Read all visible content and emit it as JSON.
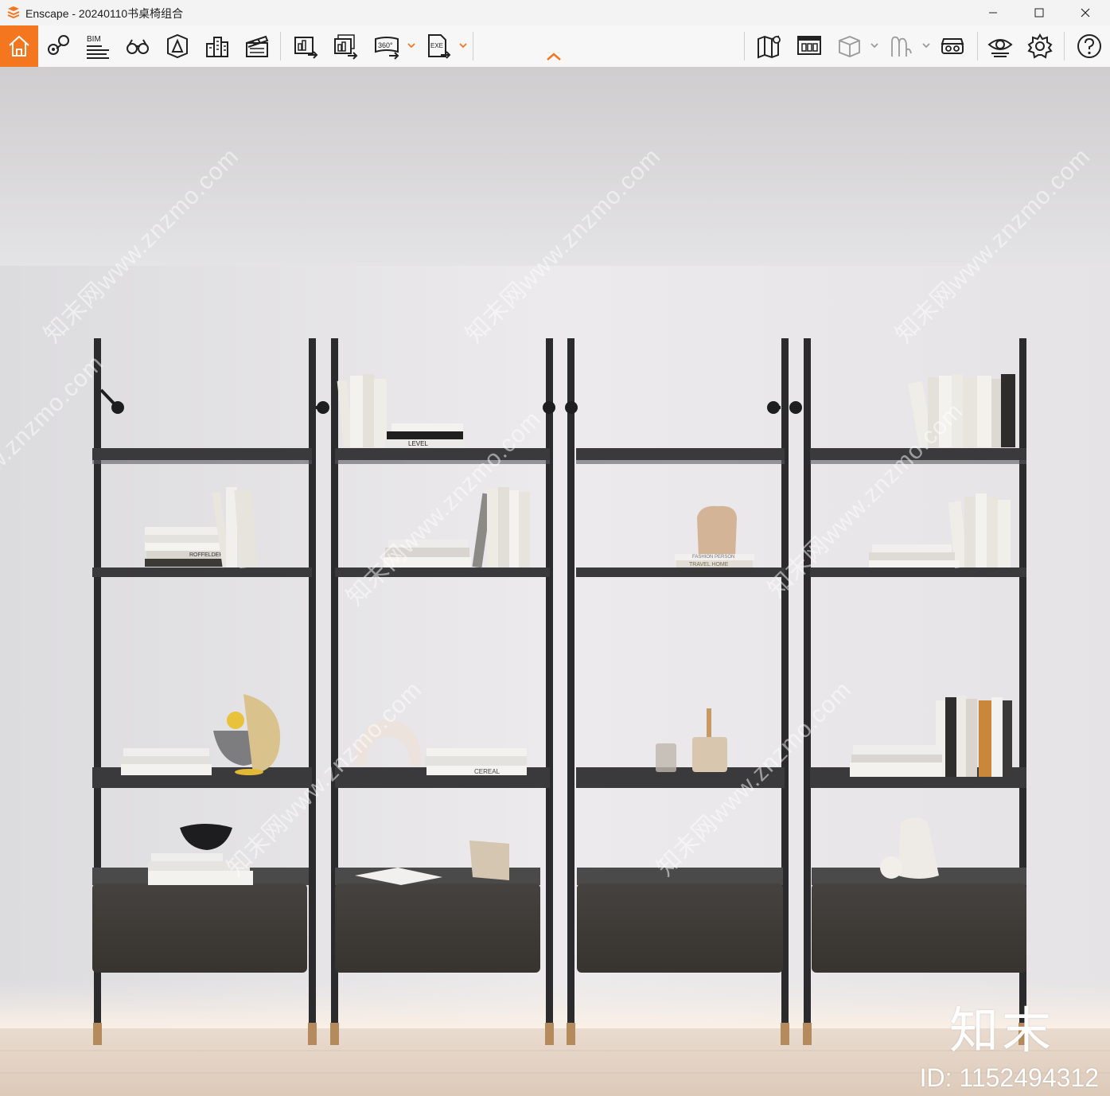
{
  "window": {
    "app_name": "Enscape",
    "title": "Enscape - 20240110书桌椅组合",
    "minimize_icon": "minimize-icon",
    "maximize_icon": "maximize-icon",
    "close_icon": "close-icon"
  },
  "toolbar": {
    "accent_color": "#f4761e",
    "bim_label": "BIM",
    "pano_label": "360°",
    "exe_label": "EXE",
    "left_tools": [
      "home-icon",
      "map-pin-icon",
      "bim-icon",
      "binoculars-icon",
      "sun-perspective-icon",
      "buildings-icon",
      "clapperboard-icon",
      "screenshot-export-icon",
      "batch-render-icon",
      "panorama-360-icon",
      "exe-export-icon"
    ],
    "right_tools": [
      "map-icon",
      "asset-library-icon",
      "cube-view-icon",
      "material-editor-icon",
      "vr-headset-icon",
      "visual-settings-icon",
      "settings-gear-icon",
      "help-icon"
    ]
  },
  "viewport": {
    "watermark_text": "知末网www.znzmo.com",
    "brand_logo_text": "知末",
    "image_id": "ID: 1152494312",
    "book_labels": {
      "b1": "LEVEL",
      "b2": "CEREAL",
      "b3": "ROFFELDER",
      "b4": "FASHION PERSON",
      "b5": "TRAVEL HOME"
    }
  }
}
